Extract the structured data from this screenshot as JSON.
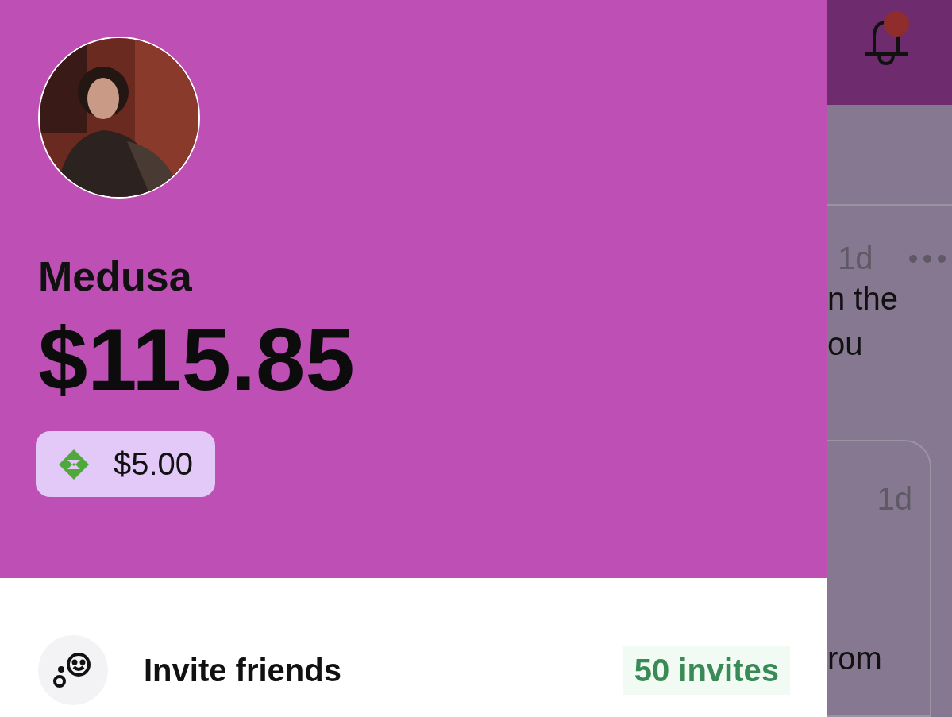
{
  "drawer": {
    "name": "Medusa",
    "balance": "$115.85",
    "credit": "$5.00",
    "menu": [
      {
        "label": "Invite friends",
        "badge": "50 invites"
      }
    ]
  },
  "background": {
    "notifications": {
      "unread": true
    },
    "posts": [
      {
        "time": "1d",
        "lines": [
          "n the",
          "ou"
        ]
      },
      {
        "time": "1d",
        "lines": [
          "rom"
        ]
      }
    ]
  }
}
